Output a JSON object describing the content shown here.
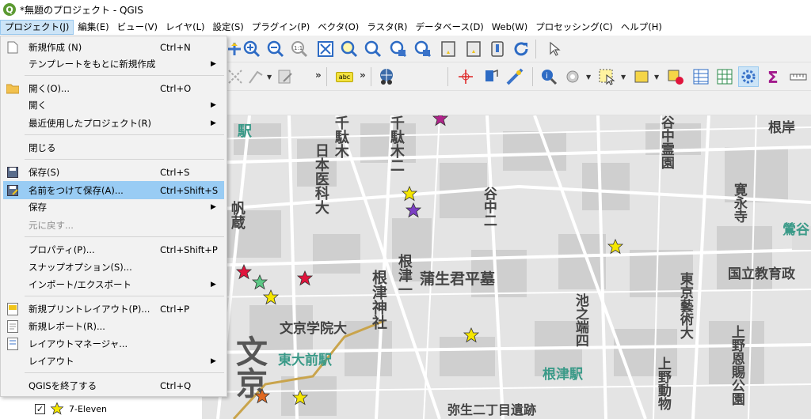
{
  "window": {
    "title": "*無題のプロジェクト - QGIS",
    "logo_letter": "Q"
  },
  "menubar": [
    "プロジェクト(J)",
    "編集(E)",
    "ビュー(V)",
    "レイヤ(L)",
    "設定(S)",
    "プラグイン(P)",
    "ベクタ(O)",
    "ラスタ(R)",
    "データベース(D)",
    "Web(W)",
    "プロセッシング(C)",
    "ヘルプ(H)"
  ],
  "toolbar": {
    "label_tool_text": "abc",
    "overflow_chevron": "»"
  },
  "project_menu": [
    {
      "label": "新規作成 (N)",
      "shortcut": "Ctrl+N",
      "icon": "new-file-icon",
      "submenu": false
    },
    {
      "label": "テンプレートをもとに新規作成",
      "shortcut": "",
      "icon": "",
      "submenu": true
    },
    {
      "label": "開く(O)...",
      "shortcut": "Ctrl+O",
      "icon": "open-folder-icon",
      "submenu": false
    },
    {
      "label": "開く",
      "shortcut": "",
      "icon": "",
      "submenu": true
    },
    {
      "label": "最近使用したプロジェクト(R)",
      "shortcut": "",
      "icon": "",
      "submenu": true
    },
    {
      "label": "閉じる",
      "shortcut": "",
      "icon": "",
      "submenu": false
    },
    {
      "label": "保存(S)",
      "shortcut": "Ctrl+S",
      "icon": "save-icon",
      "submenu": false
    },
    {
      "label": "名前をつけて保存(A)...",
      "shortcut": "Ctrl+Shift+S",
      "icon": "save-as-icon",
      "submenu": false
    },
    {
      "label": "保存",
      "shortcut": "",
      "icon": "",
      "submenu": true
    },
    {
      "label": "元に戻す...",
      "shortcut": "",
      "icon": "",
      "submenu": false
    },
    {
      "label": "プロパティ(P)...",
      "shortcut": "Ctrl+Shift+P",
      "icon": "",
      "submenu": false
    },
    {
      "label": "スナップオプション(S)...",
      "shortcut": "",
      "icon": "",
      "submenu": false
    },
    {
      "label": "インポート/エクスポート",
      "shortcut": "",
      "icon": "",
      "submenu": true
    },
    {
      "label": "新規プリントレイアウト(P)...",
      "shortcut": "Ctrl+P",
      "icon": "new-print-layout-icon",
      "submenu": false
    },
    {
      "label": "新規レポート(R)...",
      "shortcut": "",
      "icon": "new-report-icon",
      "submenu": false
    },
    {
      "label": "レイアウトマネージャ...",
      "shortcut": "",
      "icon": "layout-manager-icon",
      "submenu": false
    },
    {
      "label": "レイアウト",
      "shortcut": "",
      "icon": "",
      "submenu": true
    },
    {
      "label": "QGISを終了する",
      "shortcut": "Ctrl+Q",
      "icon": "",
      "submenu": false
    }
  ],
  "layer_panel": {
    "layer_name": "7-Eleven",
    "checked_mark": "✓"
  },
  "map_labels": {
    "sendagi": "千駄木",
    "nichii": "日本医科大",
    "hanzo": "帆蔵",
    "nezujinja": "根津神社",
    "gamou": "蒲生君平墓",
    "bunkyo_gakuin": "文京学院大",
    "todaimae": "東大前駅",
    "bunkyo": "文京",
    "yanaka": "谷中二",
    "ikenohata": "池之端四",
    "nezu_station": "根津駅",
    "tokyo_geidai": "東京藝術大",
    "kokuritsu": "国立教育政",
    "ueno_park": "上野恩賜公園",
    "ueno_zoo": "上野動物",
    "yanaka_cemetery": "谷中霊園",
    "kanei": "寛永寺",
    "negishi": "根岸",
    "uguisudani": "鶯谷",
    "yayoi": "弥生二丁目遺跡",
    "nezu_vert": "根津一",
    "sendagi2": "千駄木二",
    "eki_top": "駅"
  },
  "colors": {
    "menu_hover": "#99ccf4",
    "star_yellow": "#f5e600",
    "star_purple": "#7b3fc4",
    "star_red": "#e0143c",
    "star_green": "#5cc785",
    "star_orange": "#e06820",
    "star_magenta": "#b0238a"
  }
}
